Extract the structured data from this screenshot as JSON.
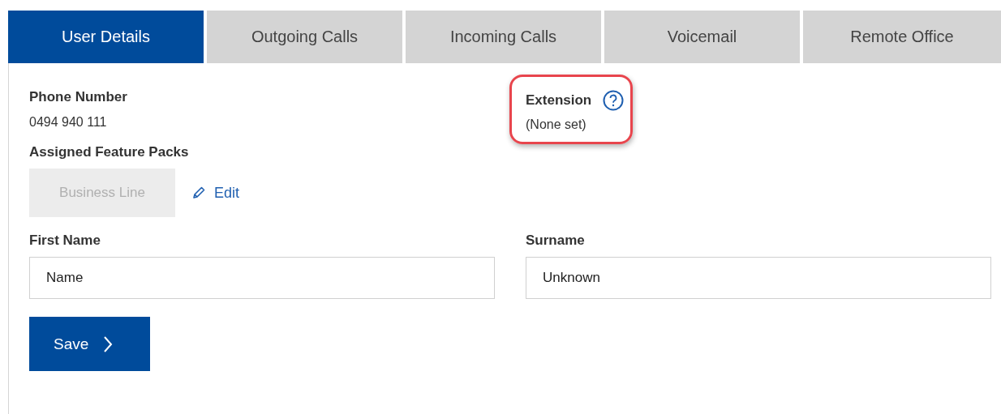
{
  "tabs": [
    {
      "label": "User Details",
      "selected": true
    },
    {
      "label": "Outgoing Calls",
      "selected": false
    },
    {
      "label": "Incoming Calls",
      "selected": false
    },
    {
      "label": "Voicemail",
      "selected": false
    },
    {
      "label": "Remote Office",
      "selected": false
    }
  ],
  "phone_number": {
    "label": "Phone Number",
    "value": "0494 940 111"
  },
  "extension": {
    "label": "Extension",
    "value": "(None set)",
    "highlighted": true
  },
  "feature_packs": {
    "label": "Assigned Feature Packs",
    "items": [
      {
        "label": "Business Line",
        "disabled": true
      }
    ],
    "edit_link": "Edit"
  },
  "fields": [
    {
      "label": "First Name",
      "value": "Name"
    },
    {
      "label": "Surname",
      "value": "Unknown"
    }
  ],
  "save_button": "Save"
}
